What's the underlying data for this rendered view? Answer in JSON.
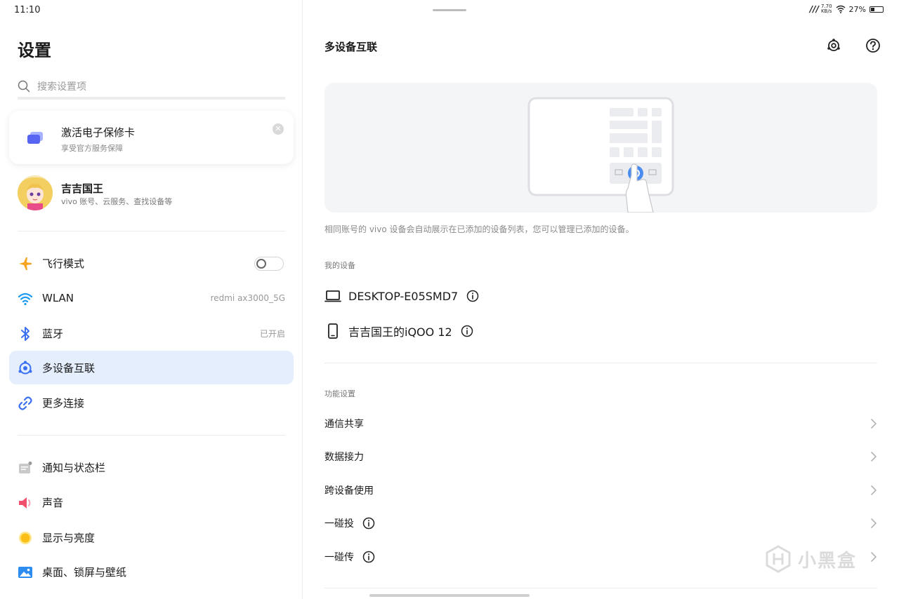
{
  "status_bar": {
    "time": "11:10",
    "net_speed_value": "7.70",
    "net_speed_unit": "KB/s",
    "battery": "27%"
  },
  "left_panel": {
    "title": "设置",
    "search_placeholder": "搜索设置项",
    "promo_card": {
      "title": "激活电子保修卡",
      "subtitle": "享受官方服务保障"
    },
    "account": {
      "name": "吉吉国王",
      "subtitle": "vivo 账号、云服务、查找设备等"
    },
    "menu_group_1": [
      {
        "label": "飞行模式",
        "value": "",
        "icon": "airplane-icon"
      },
      {
        "label": "WLAN",
        "value": "redmi ax3000_5G",
        "icon": "wifi-icon"
      },
      {
        "label": "蓝牙",
        "value": "已开启",
        "icon": "bluetooth-icon"
      },
      {
        "label": "多设备互联",
        "value": "",
        "icon": "multi-device-icon",
        "active": true
      },
      {
        "label": "更多连接",
        "value": "",
        "icon": "link-icon"
      }
    ],
    "menu_group_2": [
      {
        "label": "通知与状态栏",
        "icon": "notification-icon"
      },
      {
        "label": "声音",
        "icon": "speaker-icon"
      },
      {
        "label": "显示与亮度",
        "icon": "brightness-icon"
      },
      {
        "label": "桌面、锁屏与壁纸",
        "icon": "wallpaper-icon"
      }
    ]
  },
  "right_panel": {
    "title": "多设备互联",
    "description": "相同账号的 vivo 设备会自动展示在已添加的设备列表，您可以管理已添加的设备。",
    "my_devices_label": "我的设备",
    "devices": [
      {
        "name": "DESKTOP-E05SMD7",
        "icon": "laptop-icon"
      },
      {
        "name": "吉吉国王的iQOO 12",
        "icon": "phone-icon"
      }
    ],
    "feature_settings_label": "功能设置",
    "features": [
      {
        "label": "通信共享",
        "has_info": false
      },
      {
        "label": "数据接力",
        "has_info": false
      },
      {
        "label": "跨设备使用",
        "has_info": false
      },
      {
        "label": "一碰投",
        "has_info": true
      },
      {
        "label": "一碰传",
        "has_info": true
      }
    ]
  },
  "watermark": "小黑盒",
  "colors": {
    "accent": "#3a6ff0",
    "active_bg": "#e4eefc",
    "airplane": "#f5a623",
    "wifi": "#1f9bf0",
    "bluetooth": "#3a6ff0",
    "sound": "#f0506e",
    "brightness": "#fbbf18"
  }
}
